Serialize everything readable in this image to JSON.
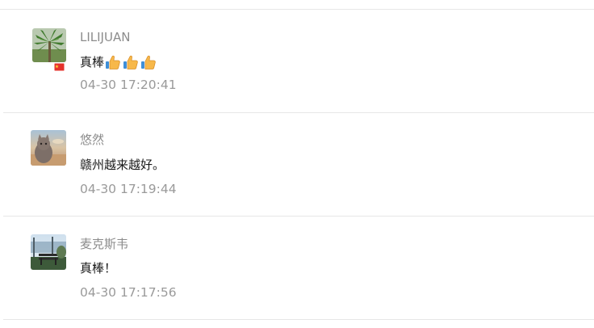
{
  "comments": [
    {
      "nickname": "LILIJUAN",
      "text": "真棒",
      "emoji": [
        "thumbs-up",
        "thumbs-up",
        "thumbs-up"
      ],
      "time": "04-30 17:20:41",
      "avatar": "palm-tree-avatar",
      "badge": "china-flag-icon"
    },
    {
      "nickname": "悠然",
      "text": "赣州越来越好。",
      "time": "04-30 17:19:44",
      "avatar": "cat-sunset-avatar"
    },
    {
      "nickname": "麦克斯韦",
      "text": "真棒！",
      "time": "04-30 17:17:56",
      "avatar": "park-bench-avatar"
    }
  ],
  "colors": {
    "nickname": "#8c8c8c",
    "text": "#1a1a1a",
    "time": "#9a9a9a",
    "divider": "#e7e7e7"
  }
}
